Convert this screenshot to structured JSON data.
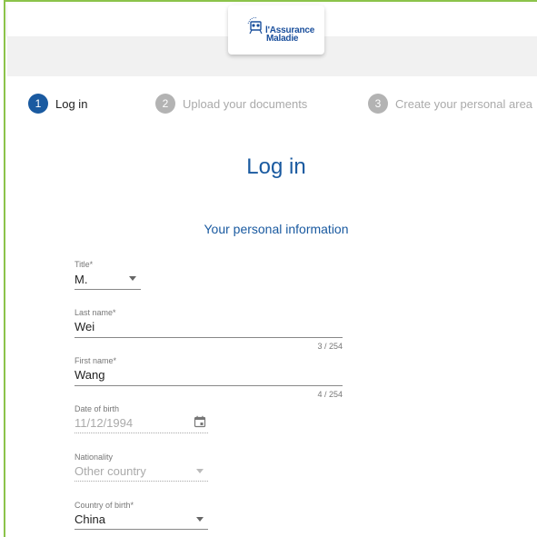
{
  "brand": {
    "line1": "l'Assurance",
    "line2": "Maladie",
    "accent": "#1a5aa0"
  },
  "steps": [
    {
      "number": "1",
      "label": "Log in",
      "active": true
    },
    {
      "number": "2",
      "label": "Upload your documents",
      "active": false
    },
    {
      "number": "3",
      "label": "Create your personal area",
      "active": false
    }
  ],
  "page": {
    "title": "Log in",
    "section": "Your personal information"
  },
  "form": {
    "title_field": {
      "label": "Title*",
      "value": "M."
    },
    "last_name": {
      "label": "Last name*",
      "value": "Wei",
      "counter": "3 / 254"
    },
    "first_name": {
      "label": "First name*",
      "value": "Wang",
      "counter": "4 / 254"
    },
    "date_of_birth": {
      "label": "Date of birth",
      "value": "11/12/1994",
      "icon": "calendar-icon"
    },
    "nationality": {
      "label": "Nationality",
      "value": "Other country"
    },
    "country_of_birth": {
      "label": "Country of birth*",
      "value": "China"
    }
  }
}
